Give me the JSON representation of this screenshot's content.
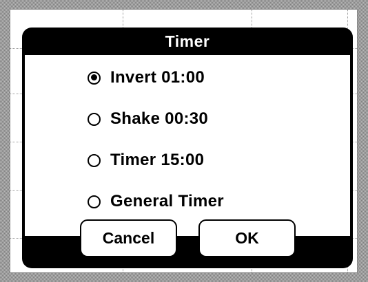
{
  "dialog": {
    "title": "Timer",
    "options": [
      {
        "label": "Invert 01:00",
        "selected": true
      },
      {
        "label": "Shake 00:30",
        "selected": false
      },
      {
        "label": "Timer 15:00",
        "selected": false
      },
      {
        "label": "General Timer",
        "selected": false
      }
    ],
    "cancel_label": "Cancel",
    "ok_label": "OK"
  },
  "colors": {
    "dialog_frame": "#000000",
    "dialog_body": "#ffffff",
    "text": "#000000",
    "title_text": "#ffffff"
  },
  "icons": {
    "radio_selected": "radio-selected-icon",
    "radio_unselected": "radio-unselected-icon"
  }
}
